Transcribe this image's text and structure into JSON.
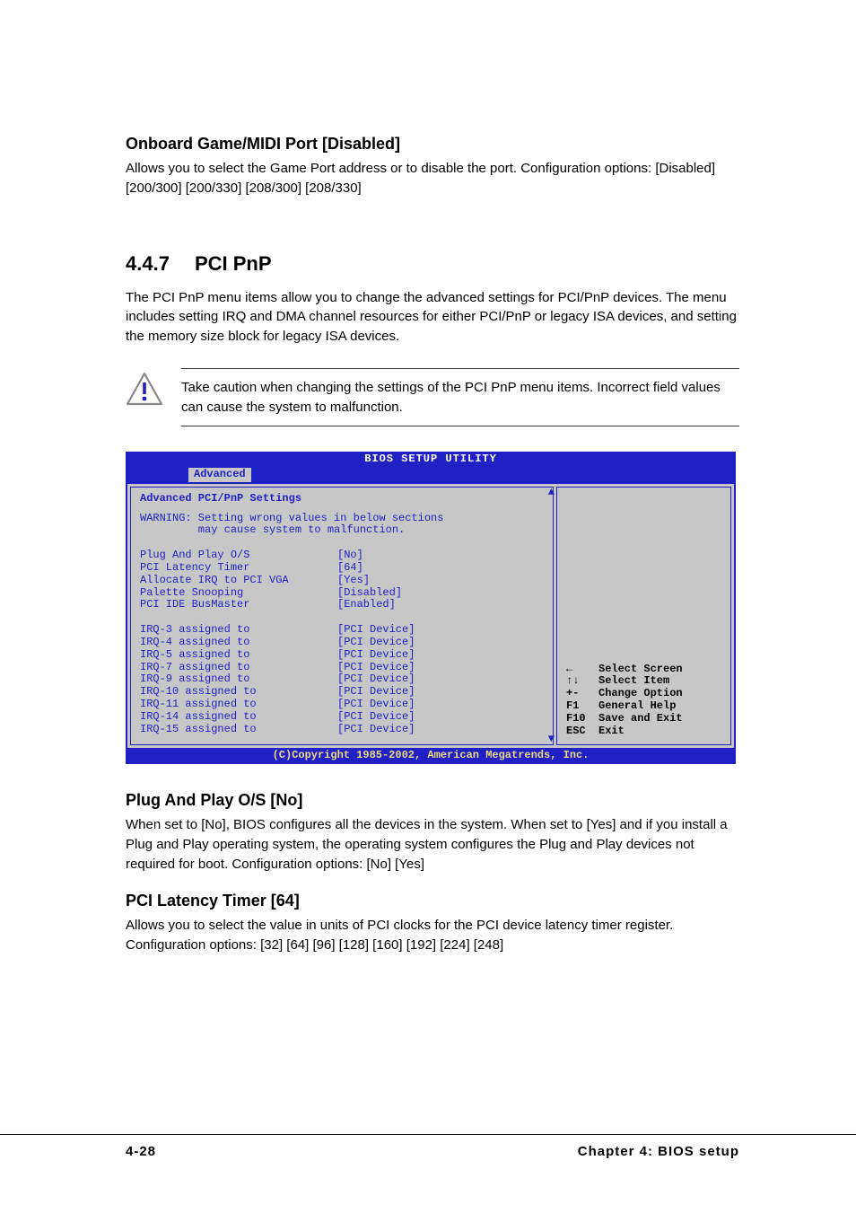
{
  "sec1": {
    "title": "Onboard Game/MIDI Port [Disabled]",
    "body": "Allows you to select the Game Port address or to disable the port. Configuration options: [Disabled] [200/300] [200/330] [208/300] [208/330]"
  },
  "sec2": {
    "num": "4.4.7",
    "title": "PCI PnP",
    "body": "The PCI PnP menu items allow you to change the advanced settings for PCI/PnP devices. The menu includes setting IRQ and DMA channel resources for either PCI/PnP or legacy ISA devices, and setting the memory size block for legacy ISA devices.",
    "caution": "Take caution when changing the settings of the PCI PnP menu items. Incorrect field values can cause the system to malfunction."
  },
  "bios": {
    "title": "BIOS SETUP UTILITY",
    "tab": "Advanced",
    "section_title": "Advanced PCI/PnP Settings",
    "warning": "WARNING: Setting wrong values in below sections\n         may cause system to malfunction.",
    "settings": [
      {
        "label": "Plug And Play O/S",
        "value": "[No]"
      },
      {
        "label": "PCI Latency Timer",
        "value": "[64]"
      },
      {
        "label": "Allocate IRQ to PCI VGA",
        "value": "[Yes]"
      },
      {
        "label": "Palette Snooping",
        "value": "[Disabled]"
      },
      {
        "label": "PCI IDE BusMaster",
        "value": "[Enabled]"
      }
    ],
    "irqs": [
      {
        "label": "IRQ-3 assigned to",
        "value": "[PCI Device]"
      },
      {
        "label": "IRQ-4 assigned to",
        "value": "[PCI Device]"
      },
      {
        "label": "IRQ-5 assigned to",
        "value": "[PCI Device]"
      },
      {
        "label": "IRQ-7 assigned to",
        "value": "[PCI Device]"
      },
      {
        "label": "IRQ-9 assigned to",
        "value": "[PCI Device]"
      },
      {
        "label": "IRQ-10 assigned to",
        "value": "[PCI Device]"
      },
      {
        "label": "IRQ-11 assigned to",
        "value": "[PCI Device]"
      },
      {
        "label": "IRQ-14 assigned to",
        "value": "[PCI Device]"
      },
      {
        "label": "IRQ-15 assigned to",
        "value": "[PCI Device]"
      }
    ],
    "nav": [
      {
        "key": "←",
        "desc": "Select Screen"
      },
      {
        "key": "↑↓",
        "desc": "Select Item"
      },
      {
        "key": "+-",
        "desc": "Change Option"
      },
      {
        "key": "F1",
        "desc": "General Help"
      },
      {
        "key": "F10",
        "desc": "Save and Exit"
      },
      {
        "key": "ESC",
        "desc": "Exit"
      }
    ],
    "footer": "(C)Copyright 1985-2002, American Megatrends, Inc."
  },
  "sec3": {
    "title": "Plug And Play O/S [No]",
    "body": "When set to [No], BIOS configures all the devices in the system. When set to [Yes] and if you install a Plug and Play operating system, the operating system configures the Plug and Play devices not required for boot. Configuration options: [No] [Yes]"
  },
  "sec4": {
    "title": "PCI Latency Timer [64]",
    "body": "Allows you to select the value in units of PCI clocks for the PCI device latency timer register. Configuration options: [32] [64] [96] [128] [160] [192] [224] [248]"
  },
  "footer": {
    "left": "4-28",
    "right": "Chapter 4: BIOS setup"
  }
}
